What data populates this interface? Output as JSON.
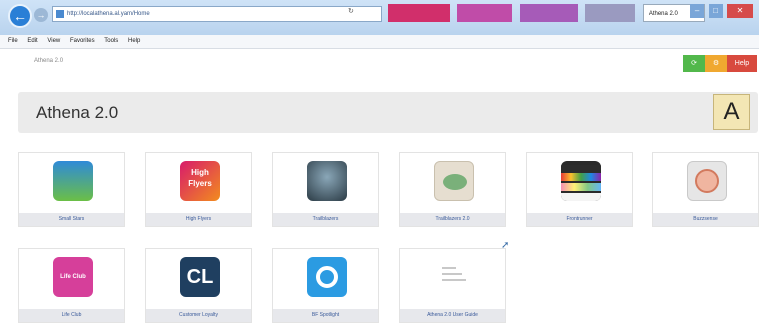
{
  "browser": {
    "address_url": "http://localathena.al.yam/Home",
    "tabs": [
      "",
      "",
      "",
      "",
      "Athena 2.0"
    ],
    "tab_colors": [
      "#d12f6b",
      "#c04ca8",
      "#a65bb8",
      "#9a9ac0"
    ],
    "menu": [
      "File",
      "Edit",
      "View",
      "Favorites",
      "Tools",
      "Help"
    ]
  },
  "header": {
    "breadcrumb": "Athena 2.0",
    "buttons": {
      "green_label": "",
      "orange_label": "",
      "help_label": "Help"
    }
  },
  "banner": {
    "title": "Athena 2.0",
    "logo_letter": "A"
  },
  "tiles": [
    {
      "label": "Small Stars",
      "icon": "small-stars-icon"
    },
    {
      "label": "High Flyers",
      "icon": "high-flyers-icon",
      "icon_text": "High Flyers"
    },
    {
      "label": "Trailblazers",
      "icon": "trailblazers-icon"
    },
    {
      "label": "Trailblazers 2.0",
      "icon": "trailblazers-2-icon"
    },
    {
      "label": "Frontrunner",
      "icon": "frontrunner-icon"
    },
    {
      "label": "Buzzsense",
      "icon": "buzzsense-icon"
    },
    {
      "label": "Life Club",
      "icon": "life-club-icon",
      "icon_text": "Life Club"
    },
    {
      "label": "Customer Loyalty",
      "icon": "customer-loyalty-icon",
      "icon_text": "CL"
    },
    {
      "label": "BF Spotlight",
      "icon": "bf-spotlight-icon"
    },
    {
      "label": "Athena 2.0 User Guide",
      "icon": "user-guide-icon"
    }
  ],
  "colors": {
    "help_button": "#d84a3e",
    "green_button": "#52b84b",
    "orange_button": "#f0a830",
    "tile_label_text": "#3a5a9a"
  }
}
